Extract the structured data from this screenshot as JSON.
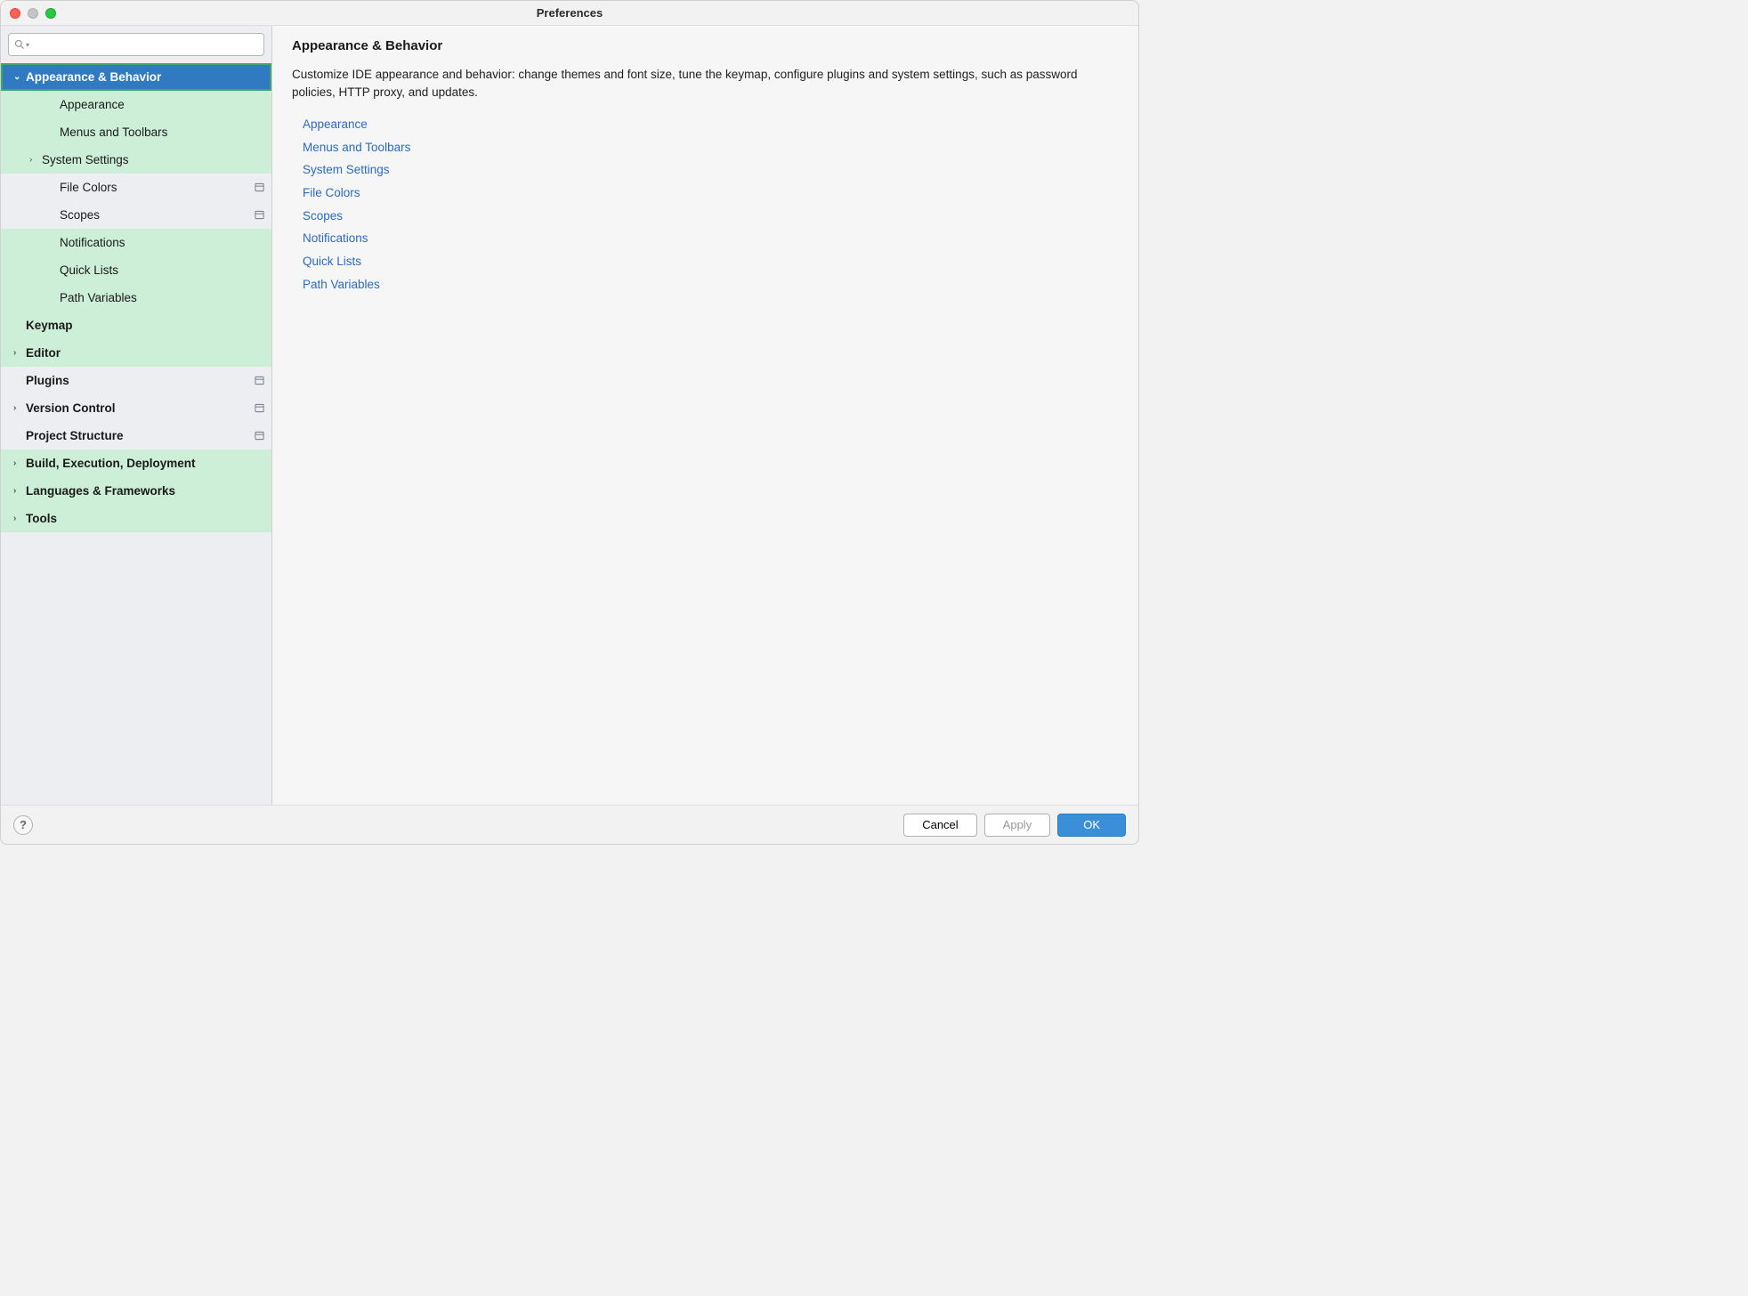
{
  "window": {
    "title": "Preferences"
  },
  "search": {
    "placeholder": ""
  },
  "tree": [
    {
      "label": "Appearance & Behavior",
      "top": true,
      "expanded": true,
      "selected": true,
      "hl": "green-border",
      "name": "appearance-behavior"
    },
    {
      "label": "Appearance",
      "indent": 2,
      "hl": "green",
      "name": "appearance"
    },
    {
      "label": "Menus and Toolbars",
      "indent": 2,
      "hl": "green",
      "name": "menus-and-toolbars"
    },
    {
      "label": "System Settings",
      "indent": 1,
      "expandable": true,
      "hl": "green",
      "name": "system-settings"
    },
    {
      "label": "File Colors",
      "indent": 2,
      "scope": true,
      "name": "file-colors"
    },
    {
      "label": "Scopes",
      "indent": 2,
      "scope": true,
      "name": "scopes"
    },
    {
      "label": "Notifications",
      "indent": 2,
      "hl": "green",
      "name": "notifications"
    },
    {
      "label": "Quick Lists",
      "indent": 2,
      "hl": "green",
      "name": "quick-lists"
    },
    {
      "label": "Path Variables",
      "indent": 2,
      "hl": "green",
      "name": "path-variables"
    },
    {
      "label": "Keymap",
      "top": true,
      "hl": "green",
      "name": "keymap"
    },
    {
      "label": "Editor",
      "top": true,
      "expandable": true,
      "hl": "green",
      "name": "editor"
    },
    {
      "label": "Plugins",
      "top": true,
      "scope": true,
      "name": "plugins"
    },
    {
      "label": "Version Control",
      "top": true,
      "expandable": true,
      "scope": true,
      "name": "version-control"
    },
    {
      "label": "Project Structure",
      "top": true,
      "scope": true,
      "name": "project-structure"
    },
    {
      "label": "Build, Execution, Deployment",
      "top": true,
      "expandable": true,
      "hl": "green",
      "name": "build-execution-deployment"
    },
    {
      "label": "Languages & Frameworks",
      "top": true,
      "expandable": true,
      "hl": "green",
      "name": "languages-frameworks"
    },
    {
      "label": "Tools",
      "top": true,
      "expandable": true,
      "hl": "green",
      "name": "tools"
    }
  ],
  "main": {
    "heading": "Appearance & Behavior",
    "description": "Customize IDE appearance and behavior: change themes and font size, tune the keymap, configure plugins and system settings, such as password policies, HTTP proxy, and updates.",
    "links": [
      "Appearance",
      "Menus and Toolbars",
      "System Settings",
      "File Colors",
      "Scopes",
      "Notifications",
      "Quick Lists",
      "Path Variables"
    ]
  },
  "footer": {
    "help": "?",
    "cancel": "Cancel",
    "apply": "Apply",
    "ok": "OK"
  }
}
